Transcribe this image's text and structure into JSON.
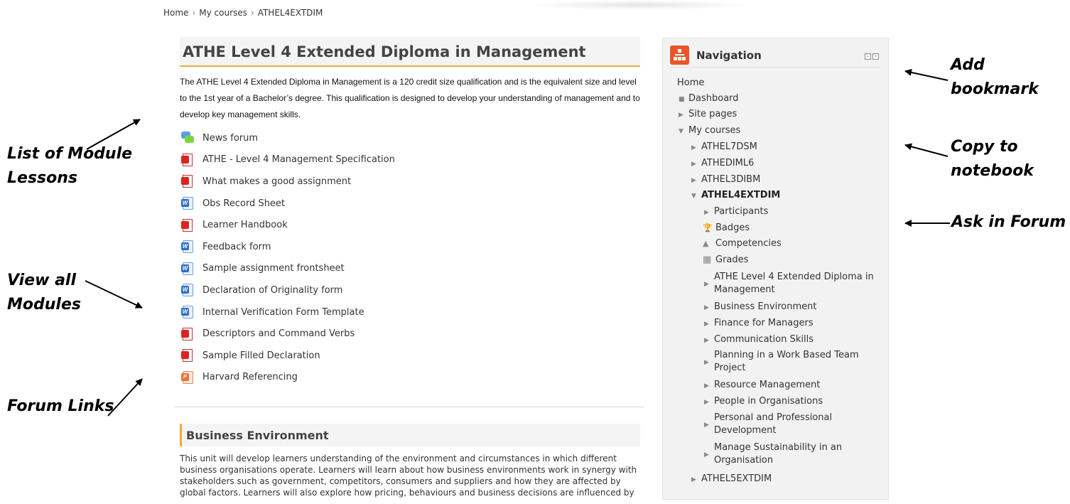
{
  "breadcrumb": [
    "Home",
    "My courses",
    "ATHEL4EXTDIM"
  ],
  "course": {
    "title": "ATHE Level 4 Extended Diploma in Management",
    "description": "The ATHE Level 4 Extended Diploma in Management is a 120 credit size qualification and is the equivalent size and level to the 1st year of a Bachelor’s degree. This qualification is designed to develop your understanding of management and to develop key management skills.",
    "activities": [
      {
        "label": "News forum",
        "icon": "forum-icon"
      },
      {
        "label": "ATHE - Level 4 Management Specification",
        "icon": "pdf-icon"
      },
      {
        "label": "What makes a good assignment",
        "icon": "pdf-icon"
      },
      {
        "label": "Obs Record Sheet",
        "icon": "word-icon"
      },
      {
        "label": "Learner Handbook",
        "icon": "pdf-icon"
      },
      {
        "label": "Feedback form",
        "icon": "word-icon"
      },
      {
        "label": "Sample assignment frontsheet",
        "icon": "word-icon"
      },
      {
        "label": "Declaration of Originality form",
        "icon": "word-icon"
      },
      {
        "label": "Internal Verification Form Template",
        "icon": "word-icon"
      },
      {
        "label": "Descriptors and Command Verbs",
        "icon": "pdf-icon"
      },
      {
        "label": "Sample Filled Declaration",
        "icon": "pdf-icon"
      },
      {
        "label": "Harvard Referencing",
        "icon": "powerpoint-icon"
      }
    ]
  },
  "section2": {
    "title": "Business Environment",
    "summary": "This unit will develop learners understanding of the environment and circumstances in which different business organisations operate. Learners will learn about how business environments work in synergy with stakeholders such as government, competitors, consumers and suppliers and how they are affected by global factors. Learners will also explore how pricing, behaviours and business decisions are influenced by"
  },
  "navigation": {
    "title": "Navigation",
    "items": [
      {
        "label": "Home",
        "marker": ""
      },
      {
        "label": "Dashboard",
        "marker": "■"
      },
      {
        "label": "Site pages",
        "marker": "▶"
      },
      {
        "label": "My courses",
        "marker": "▼"
      },
      {
        "label": "ATHEL7DSM",
        "marker": "▶"
      },
      {
        "label": "ATHEDIML6",
        "marker": "▶"
      },
      {
        "label": "ATHEL3DIBM",
        "marker": "▶"
      },
      {
        "label": "ATHEL4EXTDIM",
        "marker": "▼"
      },
      {
        "label": "Participants",
        "marker": "▶"
      },
      {
        "label": "Badges",
        "marker": "🏆"
      },
      {
        "label": "Competencies",
        "marker": "▲"
      },
      {
        "label": "Grades",
        "marker": "▦"
      },
      {
        "label": "ATHE Level 4 Extended Diploma in Management",
        "marker": "▶"
      },
      {
        "label": "Business Environment",
        "marker": "▶"
      },
      {
        "label": "Finance for Managers",
        "marker": "▶"
      },
      {
        "label": "Communication Skills",
        "marker": "▶"
      },
      {
        "label": "Planning in a Work Based Team Project",
        "marker": "▶"
      },
      {
        "label": "Resource Management",
        "marker": "▶"
      },
      {
        "label": "People in Organisations",
        "marker": "▶"
      },
      {
        "label": "Personal and Professional Development",
        "marker": "▶"
      },
      {
        "label": "Manage Sustainability in an Organisation",
        "marker": "▶"
      },
      {
        "label": "ATHEL5EXTDIM",
        "marker": "▶"
      }
    ]
  },
  "annotations": {
    "list_of_module_lessons": [
      "List of Module",
      "Lessons"
    ],
    "view_all_modules": [
      "View all",
      "Modules"
    ],
    "forum_links": "Forum Links",
    "add_bookmark": [
      "Add",
      "bookmark"
    ],
    "copy_to_notebook": [
      "Copy to",
      "notebook"
    ],
    "ask_in_forum": "Ask in Forum"
  },
  "colors": {
    "accent": "#f2a93b",
    "nav_icon": "#e8562a",
    "pdf": "#d22222",
    "word": "#2f6cc4",
    "forum_a": "#5b9ee6",
    "forum_b": "#7ed23b"
  }
}
